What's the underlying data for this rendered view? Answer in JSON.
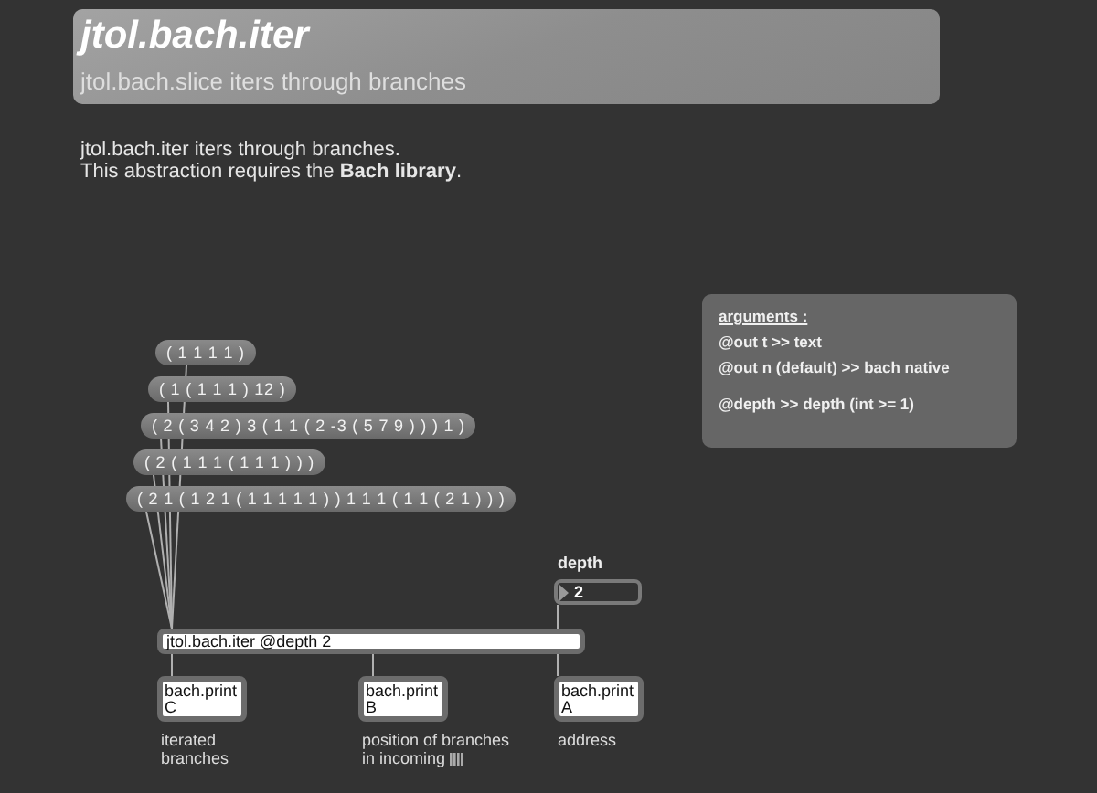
{
  "title": "jtol.bach.iter",
  "subtitle": "jtol.bach.slice iters through branches",
  "description": [
    "jtol.bach.iter iters through branches.",
    "This abstraction requires the **Bach library**."
  ],
  "messages": [
    "( 1 1 1 1 )",
    "( 1 ( 1 1 1 ) 12 )",
    "( 2 ( 3 4 2 ) 3 ( 1 1 ( 2 -3 ( 5 7 9 ) ) ) 1 )",
    "( 2 ( 1 1 1 ( 1 1 1 ) ) )",
    "( 2 1 ( 1 2 1 ( 1 1 1 1 1 ) ) 1 1 1 ( 1 1 ( 2 1 ) ) )"
  ],
  "depth": {
    "label": "depth",
    "value": "2"
  },
  "object": "jtol.bach.iter @depth 2",
  "prints": [
    {
      "name": "bach.print",
      "arg": "C",
      "comment": [
        "iterated",
        "branches"
      ]
    },
    {
      "name": "bach.print",
      "arg": "B",
      "comment": [
        "position of branches",
        "in incoming"
      ]
    },
    {
      "name": "bach.print",
      "arg": "A",
      "comment": [
        "address"
      ]
    }
  ],
  "arguments": {
    "heading": "arguments :",
    "lines": [
      "@out t >> text",
      "@out n  (default) >> bach native",
      "@depth >> depth (int >= 1)"
    ]
  }
}
